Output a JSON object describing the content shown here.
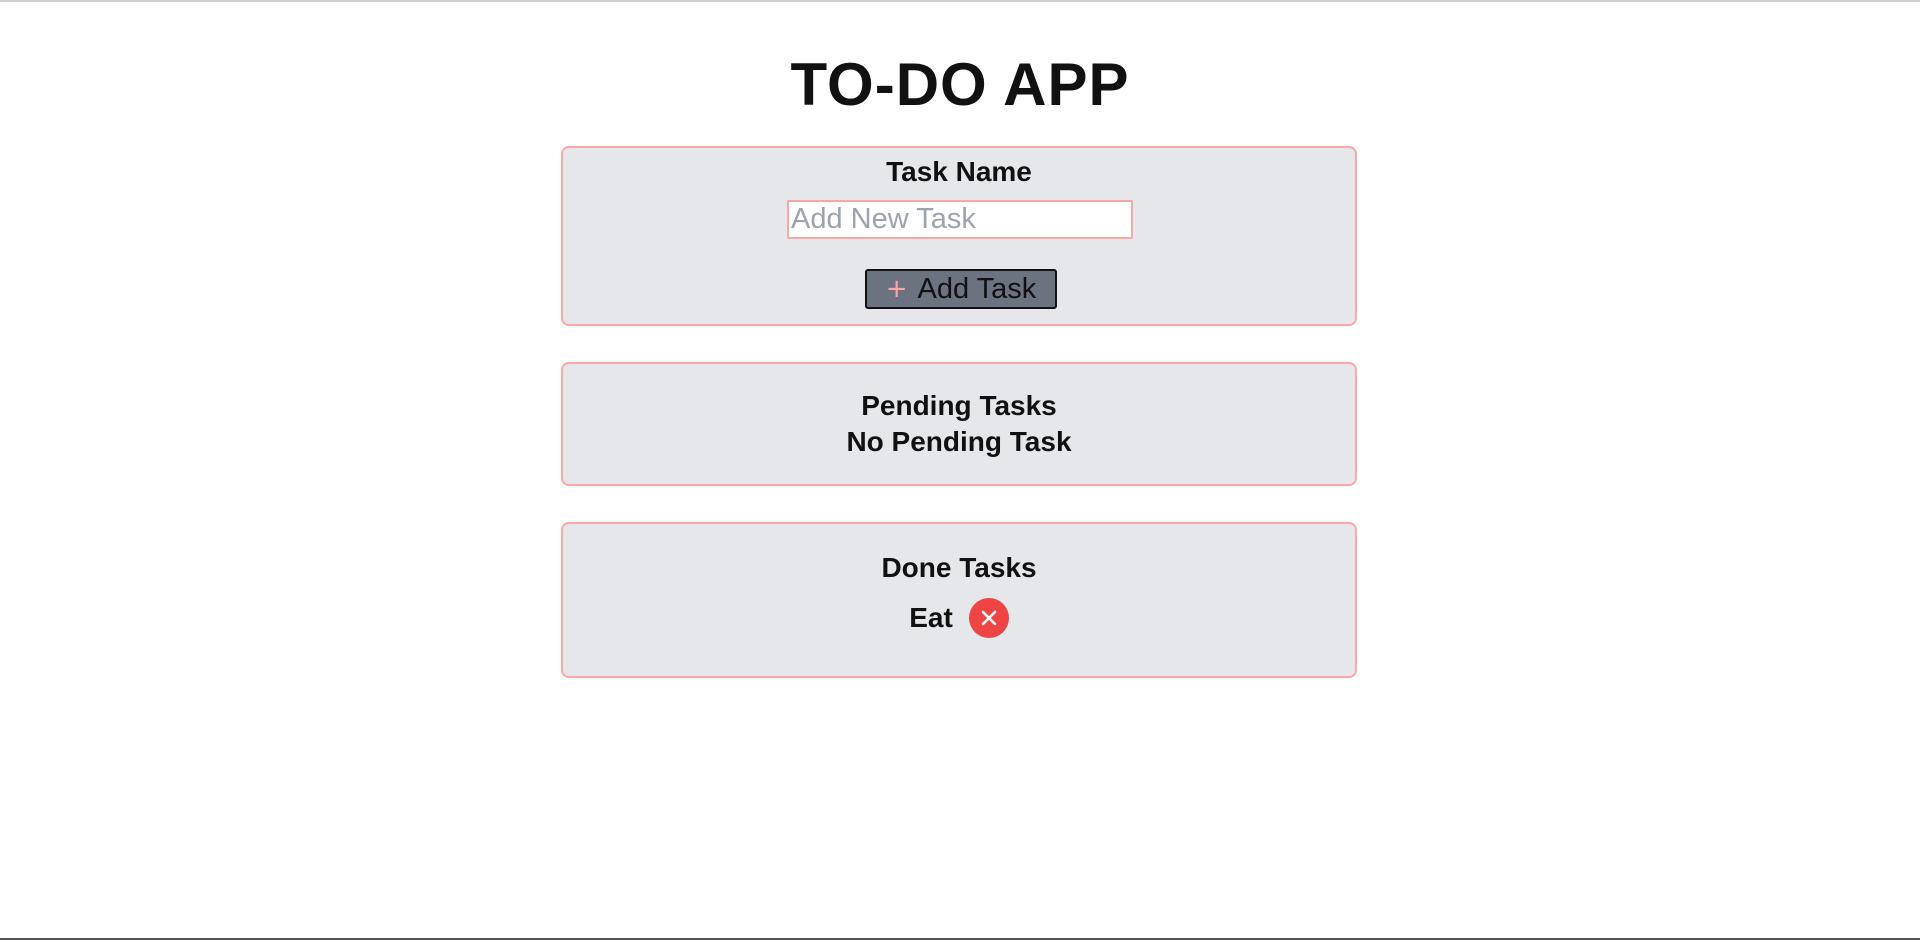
{
  "app": {
    "title": "TO-DO APP"
  },
  "add_task": {
    "label": "Task Name",
    "input_value": "",
    "input_placeholder": "Add New Task",
    "button_icon": "plus-icon",
    "button_label": "Add Task"
  },
  "pending": {
    "heading": "Pending Tasks",
    "empty_message": "No Pending Task",
    "items": []
  },
  "done": {
    "heading": "Done Tasks",
    "items": [
      {
        "text": "Eat",
        "remove_icon": "close-circle-icon"
      }
    ]
  },
  "colors": {
    "card_background": "#e5e7eb",
    "card_border": "#fca5a5",
    "button_background": "#6b7280",
    "remove_button": "#ef4444",
    "placeholder": "#9ca3af"
  }
}
